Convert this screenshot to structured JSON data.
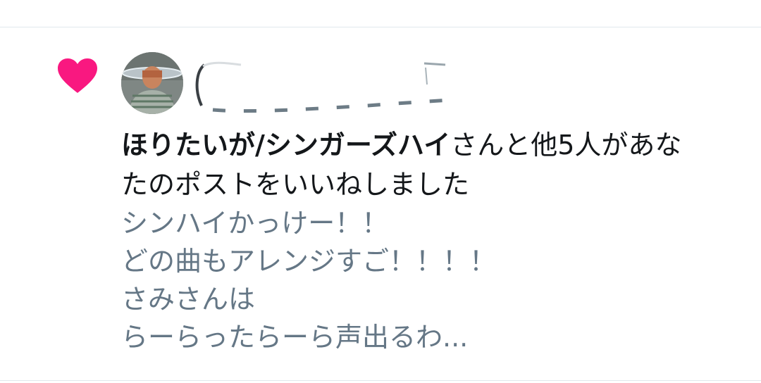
{
  "notification": {
    "type_icon": "heart-icon",
    "actor_name": "ほりたいが/シンガーズハイ",
    "summary_rest_line1": "さんと他5人があな",
    "summary_line2": "たのポストをいいねしました",
    "post_lines": [
      "シンハイかっけー！！",
      "どの曲もアレンジすご！！！！",
      "さみさんは",
      "らーらったらーら声出るわ..."
    ]
  },
  "colors": {
    "like": "#f91880",
    "primary_text": "#14171a",
    "secondary_text": "#657786",
    "divider": "#e1e8ed"
  }
}
